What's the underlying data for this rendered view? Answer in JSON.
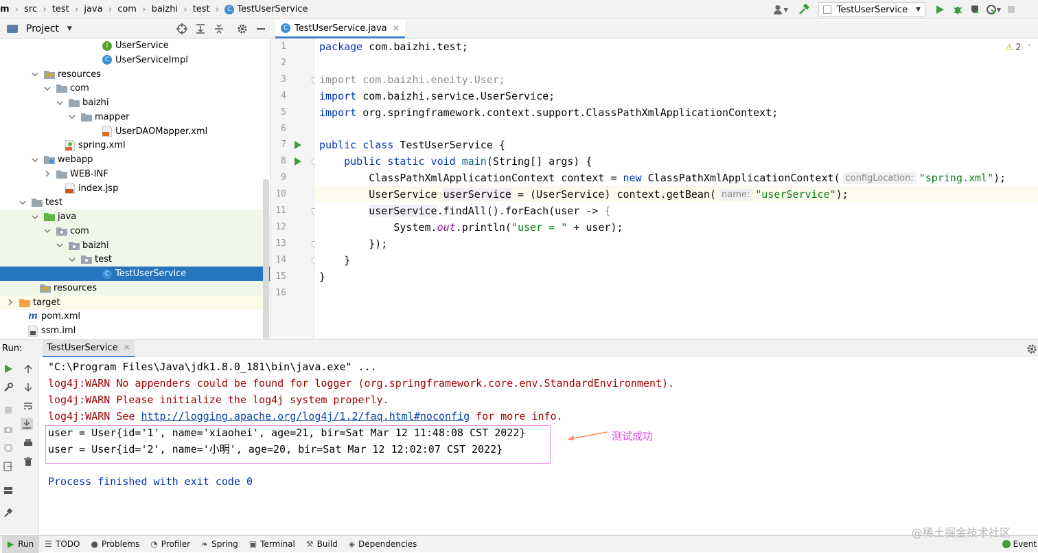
{
  "breadcrumb": [
    "m",
    "src",
    "test",
    "java",
    "com",
    "baizhi",
    "test",
    "TestUserService"
  ],
  "run_config": "TestUserService",
  "project_header": "Project",
  "tree": [
    {
      "label": "UserService",
      "depth": 8,
      "icon": "interface-icon",
      "chev": ""
    },
    {
      "label": "UserServiceImpl",
      "depth": 8,
      "icon": "class-icon",
      "chev": ""
    },
    {
      "label": "resources",
      "depth": 3,
      "icon": "resources-folder-icon",
      "chev": "v"
    },
    {
      "label": "com",
      "depth": 4,
      "icon": "folder-icon",
      "chev": "v"
    },
    {
      "label": "baizhi",
      "depth": 5,
      "icon": "folder-icon",
      "chev": "v"
    },
    {
      "label": "mapper",
      "depth": 6,
      "icon": "folder-icon",
      "chev": "v"
    },
    {
      "label": "UserDAOMapper.xml",
      "depth": 8,
      "icon": "xml-icon",
      "chev": ""
    },
    {
      "label": "spring.xml",
      "depth": 5,
      "icon": "spring-xml-icon",
      "chev": ""
    },
    {
      "label": "webapp",
      "depth": 3,
      "icon": "web-folder-icon",
      "chev": "v"
    },
    {
      "label": "WEB-INF",
      "depth": 4,
      "icon": "folder-icon",
      "chev": ">"
    },
    {
      "label": "index.jsp",
      "depth": 5,
      "icon": "jsp-icon",
      "chev": ""
    },
    {
      "label": "test",
      "depth": 2,
      "icon": "folder-icon",
      "chev": "v"
    },
    {
      "label": "java",
      "depth": 3,
      "icon": "test-src-folder-icon",
      "chev": "v"
    },
    {
      "label": "com",
      "depth": 4,
      "icon": "package-icon",
      "chev": "v"
    },
    {
      "label": "baizhi",
      "depth": 5,
      "icon": "package-icon",
      "chev": "v"
    },
    {
      "label": "test",
      "depth": 6,
      "icon": "package-icon",
      "chev": "v"
    },
    {
      "label": "TestUserService",
      "depth": 8,
      "icon": "class-icon",
      "chev": "",
      "selected": true
    },
    {
      "label": "resources",
      "depth": 3,
      "icon": "resources-folder-icon",
      "chev": ""
    },
    {
      "label": "target",
      "depth": 1,
      "icon": "orange-folder-icon",
      "chev": ">"
    },
    {
      "label": "pom.xml",
      "depth": 2,
      "icon": "maven-icon",
      "chev": ""
    },
    {
      "label": "ssm.iml",
      "depth": 2,
      "icon": "iml-icon",
      "chev": ""
    }
  ],
  "editor_tab": "TestUserService.java",
  "warnings_count": "2",
  "line_numbers": [
    "1",
    "2",
    "3",
    "4",
    "5",
    "6",
    "7",
    "8",
    "9",
    "10",
    "11",
    "12",
    "13",
    "14",
    "15",
    "16"
  ],
  "code": {
    "l1": [
      "package",
      " com.baizhi.test;"
    ],
    "l3": [
      "import com.baizhi.eneity.User;"
    ],
    "l4": [
      "import",
      " com.baizhi.service.UserService;"
    ],
    "l5": [
      "import",
      " org.springframework.context.support.ClassPathXmlApplicationContext;"
    ],
    "l7": [
      "public class",
      " TestUserService {"
    ],
    "l8": [
      "    public static void ",
      "main",
      "(String[] args) {"
    ],
    "l9": [
      "        ClassPathXmlApplicationContext context = ",
      "new",
      " ClassPathXmlApplicationContext(",
      "configLocation:",
      "\"spring.xml\"",
      ");"
    ],
    "l10": [
      "        UserService ",
      "userService",
      " = (UserService) context.getBean(",
      "name:",
      "\"userService\"",
      ");"
    ],
    "l11": [
      "        ",
      "userService",
      ".findAll().forEach(user -> ",
      "{"
    ],
    "l12": [
      "            System.",
      "out",
      ".println(",
      "\"user = \"",
      " + user);"
    ],
    "l13": [
      "        });"
    ],
    "l14": [
      "    }"
    ],
    "l15": [
      "}"
    ]
  },
  "run": {
    "label": "Run:",
    "tab": "TestUserService",
    "lines": {
      "cmd": "\"C:\\Program Files\\Java\\jdk1.8.0_181\\bin\\java.exe\" ...",
      "warn1": "log4j:WARN No appenders could be found for logger (org.springframework.core.env.StandardEnvironment).",
      "warn2": "log4j:WARN Please initialize the log4j system properly.",
      "warn3_pre": "log4j:WARN See ",
      "warn3_link": "http://logging.apache.org/log4j/1.2/faq.html#noconfig",
      "warn3_post": " for more info.",
      "user1": "user = User{id='1', name='xiaohei', age=21, bir=Sat Mar 12 11:48:08 CST 2022}",
      "user2": "user = User{id='2', name='小明', age=20, bir=Sat Mar 12 12:02:07 CST 2022}",
      "exit": "Process finished with exit code 0"
    },
    "annotation": "测试成功"
  },
  "statusbar": {
    "tabs": [
      "Run",
      "TODO",
      "Problems",
      "Profiler",
      "Spring",
      "Terminal",
      "Build",
      "Dependencies"
    ],
    "event": "Event",
    "watermark": "@稀土掘金技术社区"
  },
  "colors": {
    "selection": "#2675bf",
    "annotation": "#e040e0",
    "box": "#f08be2",
    "run_green": "#3c9b3c"
  }
}
